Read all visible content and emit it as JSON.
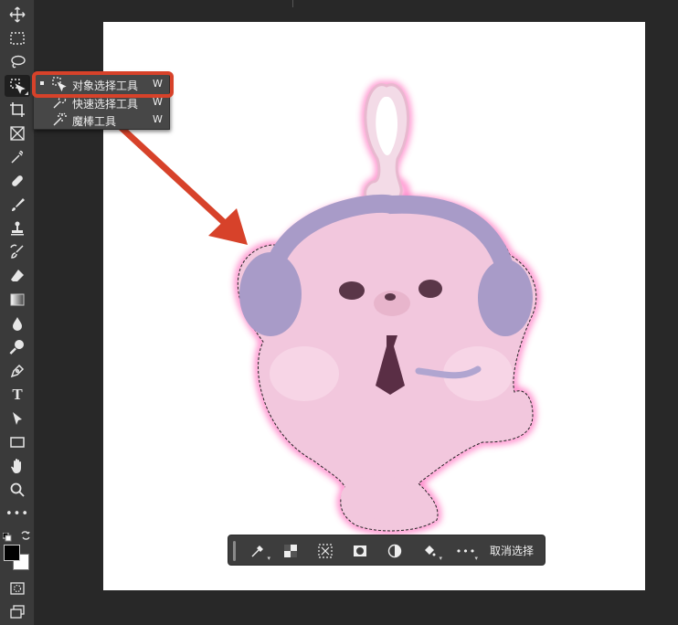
{
  "flyout": {
    "items": [
      {
        "label": "对象选择工具",
        "key": "W",
        "active": true
      },
      {
        "label": "快速选择工具",
        "key": "W",
        "active": false
      },
      {
        "label": "魔棒工具",
        "key": "W",
        "active": false
      }
    ]
  },
  "taskbar": {
    "deselect_label": "取消选择"
  },
  "colors": {
    "highlight": "#d7422a",
    "arrow": "#d7422a",
    "selection_glow": "#ff4fb0",
    "plush": "#f2c7dd",
    "headphone": "#a89bc8",
    "foreground": "#000000",
    "background": "#ffffff"
  },
  "tools": [
    "move-icon",
    "marquee-icon",
    "lasso-icon",
    "object-selection-icon",
    "crop-icon",
    "frame-icon",
    "eyedropper-icon",
    "healing-brush-icon",
    "brush-icon",
    "clone-stamp-icon",
    "history-brush-icon",
    "eraser-icon",
    "gradient-icon",
    "blur-icon",
    "dodge-icon",
    "pen-icon",
    "type-icon",
    "path-selection-icon",
    "rectangle-icon",
    "hand-icon",
    "zoom-icon",
    "more-tools-icon"
  ]
}
